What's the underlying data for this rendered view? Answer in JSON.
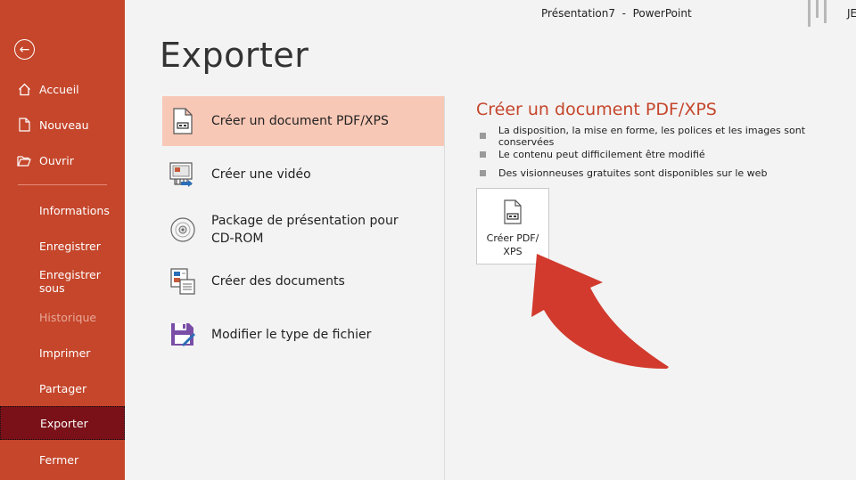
{
  "titlebar": {
    "text": "Présentation7  -  PowerPoint",
    "user_initials": "JE"
  },
  "sidebar": {
    "back_icon": "back-arrow-icon",
    "items": [
      {
        "label": "Accueil",
        "icon": "home-icon"
      },
      {
        "label": "Nouveau",
        "icon": "new-file-icon"
      },
      {
        "label": "Ouvrir",
        "icon": "open-folder-icon"
      },
      {
        "label": "Informations"
      },
      {
        "label": "Enregistrer"
      },
      {
        "label": "Enregistrer sous"
      },
      {
        "label": "Historique",
        "disabled": true
      },
      {
        "label": "Imprimer"
      },
      {
        "label": "Partager"
      },
      {
        "label": "Exporter",
        "active": true
      },
      {
        "label": "Fermer"
      }
    ]
  },
  "page_title": "Exporter",
  "options": [
    {
      "label": "Créer un document PDF/XPS",
      "icon": "pdf-document-icon",
      "selected": true
    },
    {
      "label": "Créer une vidéo",
      "icon": "video-icon"
    },
    {
      "label": "Package de présentation pour",
      "label2": "CD-ROM",
      "icon": "cd-rom-icon"
    },
    {
      "label": "Créer des documents",
      "icon": "handouts-icon"
    },
    {
      "label": "Modifier le type de fichier",
      "icon": "save-as-type-icon"
    }
  ],
  "detail": {
    "title": "Créer un document PDF/XPS",
    "bullets": [
      "La disposition, la mise en forme, les polices et les images sont conservées",
      "Le contenu peut difficilement être modifié",
      "Des visionneuses gratuites sont disponibles sur le web"
    ],
    "button_label": "Créer PDF/\nXPS"
  },
  "colors": {
    "sidebar": "#c5462b",
    "active_item": "#7a1118",
    "selected_option": "#f8c8b6",
    "accent_title": "#c5462b",
    "arrow": "#d13a2d"
  }
}
